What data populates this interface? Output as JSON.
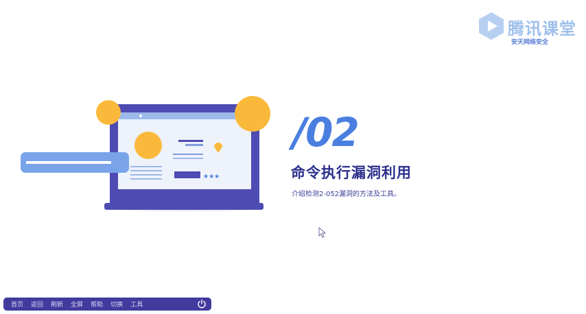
{
  "logo": {
    "name": "腾讯课堂",
    "subtitle": "安天网络安全",
    "icon": "play-icon",
    "color": "#9fc0ec"
  },
  "slide": {
    "number": "/02",
    "title": "命令执行漏洞利用",
    "description": "介绍检测2-052漏洞的方法及工具。"
  },
  "taskbar": {
    "items": [
      "首页",
      "返回",
      "刷新",
      "全屏",
      "帮助",
      "切换",
      "工具"
    ],
    "power_icon": "power-icon"
  },
  "colors": {
    "accent": "#4a7fe0",
    "title": "#2b2f8c",
    "taskbar": "#433a9e",
    "circle": "#fbb93c"
  }
}
